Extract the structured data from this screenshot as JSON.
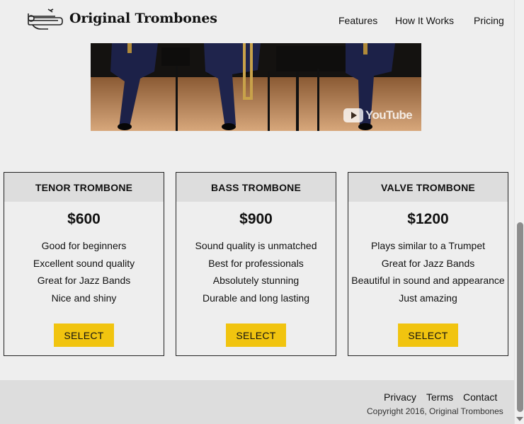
{
  "header": {
    "brand": "Original Trombones",
    "logo_icon": "trombone-icon",
    "nav": [
      "Features",
      "How It Works",
      "Pricing"
    ]
  },
  "video": {
    "provider_mark": "YouTube",
    "icon": "youtube-play-icon"
  },
  "pricing": {
    "accent_color": "#f1c40f",
    "cards": [
      {
        "title": "TENOR TROMBONE",
        "price": "$600",
        "features": [
          "Good for beginners",
          "Excellent sound quality",
          "Great for Jazz Bands",
          "Nice and shiny"
        ],
        "button": "SELECT"
      },
      {
        "title": "BASS TROMBONE",
        "price": "$900",
        "features": [
          "Sound quality is unmatched",
          "Best for professionals",
          "Absolutely stunning",
          "Durable and long lasting"
        ],
        "button": "SELECT"
      },
      {
        "title": "VALVE TROMBONE",
        "price": "$1200",
        "features": [
          "Plays similar to a Trumpet",
          "Great for Jazz Bands",
          "Beautiful in sound and appearance",
          "Just amazing"
        ],
        "button": "SELECT"
      }
    ]
  },
  "footer": {
    "links": [
      "Privacy",
      "Terms",
      "Contact"
    ],
    "copyright": "Copyright 2016, Original Trombones"
  }
}
